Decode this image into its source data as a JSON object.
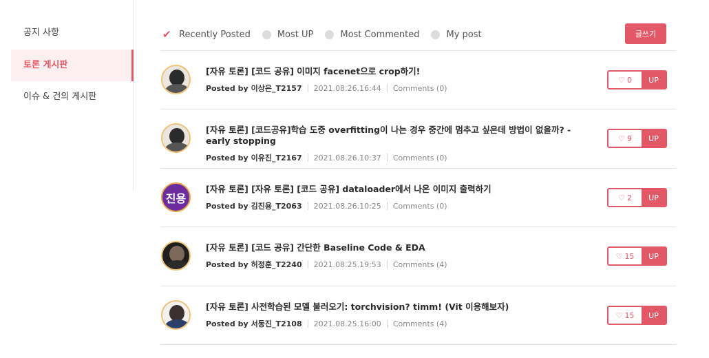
{
  "sidebar": {
    "items": [
      {
        "label": "공지 사항"
      },
      {
        "label": "토론 게시판"
      },
      {
        "label": "이슈 & 건의 게시판"
      }
    ]
  },
  "filters": {
    "items": [
      {
        "label": "Recently Posted",
        "selected": true
      },
      {
        "label": "Most UP",
        "selected": false
      },
      {
        "label": "Most Commented",
        "selected": false
      },
      {
        "label": "My post",
        "selected": false
      }
    ]
  },
  "toolbar": {
    "write_label": "글쓰기"
  },
  "posts": [
    {
      "title": "[자유 토론] [코드 공유] 이미지 facenet으로 crop하기!",
      "posted_by_prefix": "Posted by",
      "author": "이상은_T2157",
      "date": "2021.08.26.16:44",
      "comments": "Comments (0)",
      "likes": "0",
      "up_label": "UP"
    },
    {
      "title": "[자유 토론] [코드공유]학습 도중 overfitting이 나는 경우 중간에 멈추고 싶은데 방법이 없을까? - early stopping",
      "posted_by_prefix": "Posted by",
      "author": "이유진_T2167",
      "date": "2021.08.26.10:37",
      "comments": "Comments (0)",
      "likes": "9",
      "up_label": "UP"
    },
    {
      "title": "[자유 토론] [자유 토론] [코드 공유] dataloader에서 나온 이미지 출력하기",
      "posted_by_prefix": "Posted by",
      "author": "김진용_T2063",
      "date": "2021.08.26.10:25",
      "comments": "Comments (0)",
      "likes": "2",
      "up_label": "UP",
      "avatar_text": "진용"
    },
    {
      "title": "[자유 토론] [코드 공유] 간단한 Baseline Code & EDA",
      "posted_by_prefix": "Posted by",
      "author": "허정훈_T2240",
      "date": "2021.08.25.19:53",
      "comments": "Comments (4)",
      "likes": "15",
      "up_label": "UP"
    },
    {
      "title": "[자유 토론] 사전학습된 모델 불러오기: torchvision? timm! (Vit 이용해보자)",
      "posted_by_prefix": "Posted by",
      "author": "서동진_T2108",
      "date": "2021.08.25.16:00",
      "comments": "Comments (4)",
      "likes": "15",
      "up_label": "UP"
    }
  ],
  "colors": {
    "accent": "#e35866",
    "active_bg": "#fbeff1",
    "divider": "#e4e4e4"
  },
  "icons": {
    "filter_selected": "checkmark-icon",
    "filter_unselected": "radio-dot-icon",
    "like": "heart-icon"
  }
}
